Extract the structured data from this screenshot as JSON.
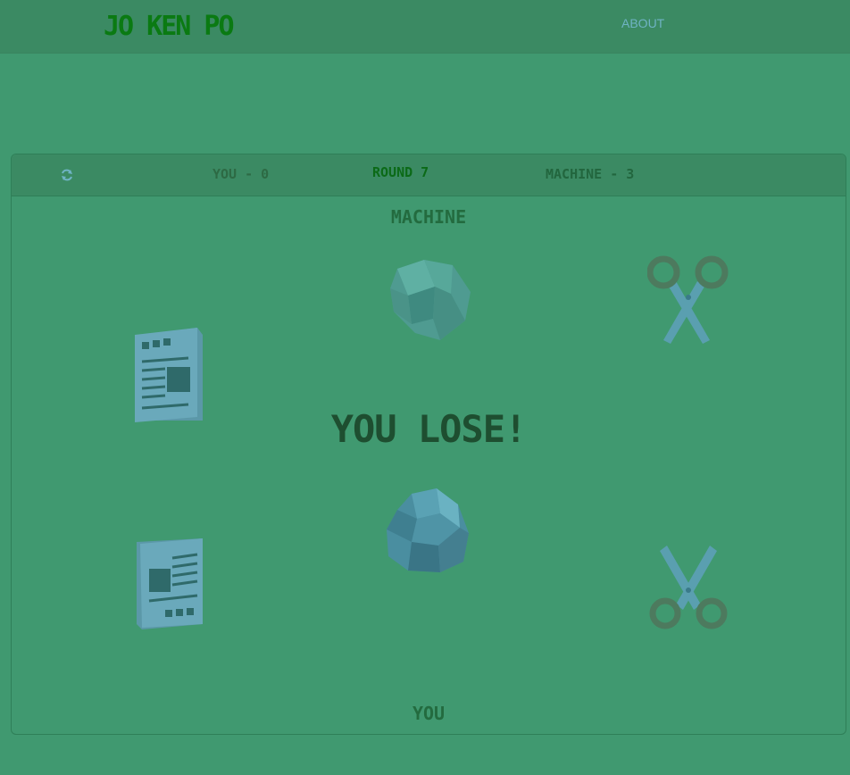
{
  "navbar": {
    "brand": "JO KEN PO",
    "about_label": "ABOUT"
  },
  "scoreboard": {
    "you_score": "YOU - 0",
    "round": "ROUND 7",
    "machine_score": "MACHINE - 3"
  },
  "machine_label": "MACHINE",
  "you_label": "YOU",
  "result_text": "YOU LOSE!",
  "icons": {
    "refresh": "refresh-icon",
    "paper": "paper-icon",
    "rock": "rock-icon",
    "scissors": "scissors-icon"
  },
  "colors": {
    "background": "#409970",
    "navbar": "#3b8a63",
    "brand": "#0a7a12",
    "link": "#6fb3c4",
    "result": "#1e4e30"
  }
}
